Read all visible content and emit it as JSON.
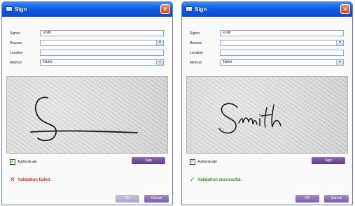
{
  "dialogs": [
    {
      "title": "Sign",
      "labels": {
        "signer": "Signer",
        "reason": "Reason",
        "location": "Location",
        "method": "Method"
      },
      "signer_value": "smith",
      "reason_value": "",
      "location_value": "",
      "method_value": "Tablet",
      "authenticate_label": "Authenticate",
      "authenticate_checked": true,
      "sign_button": "Sign",
      "status_text": "Validation failed.",
      "status_kind": "failed",
      "status_color": "#d02a2a",
      "ok_button": "OK",
      "ok_enabled": false,
      "cancel_button": "Cancel"
    },
    {
      "title": "Sign",
      "labels": {
        "signer": "Signer",
        "reason": "Reason",
        "location": "Location",
        "method": "Method"
      },
      "signer_value": "smith",
      "reason_value": "",
      "location_value": "",
      "method_value": "Tablet",
      "authenticate_label": "Authenticate",
      "authenticate_checked": true,
      "sign_button": "Sign",
      "status_text": "Validation successful.",
      "status_kind": "success",
      "status_color": "#2c8f2c",
      "ok_button": "OK",
      "ok_enabled": true,
      "cancel_button": "Cancel"
    }
  ],
  "icons": {
    "window": "window-icon",
    "close": "close-icon",
    "dropdown": "chevron-down-icon",
    "check": "checkmark-icon",
    "fail": "x-mark-icon",
    "success": "checkmark-icon"
  },
  "colors": {
    "titlebar": "#1060e0",
    "button_purple": "#6e4a9a",
    "fail_red": "#d02a2a",
    "success_green": "#2c8f2c"
  }
}
